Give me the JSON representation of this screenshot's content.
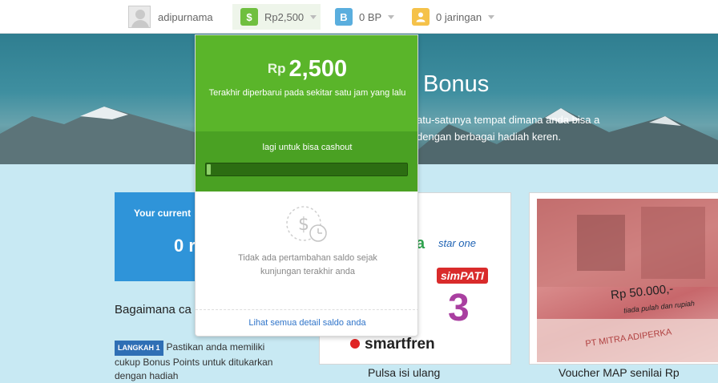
{
  "header": {
    "username": "adipurnama",
    "balance_label": "Rp2,500",
    "balance_icon_letter": "$",
    "bp_label": "0 BP",
    "bp_icon_letter": "B",
    "network_label": "0 jaringan",
    "colors": {
      "balance": "#6fbf3f",
      "bp": "#5aaede",
      "network": "#f5c24a"
    }
  },
  "hero": {
    "title": "Bonus",
    "text": "atu-satunya tempat dimana anda bisa a dengan berbagai hadiah keren."
  },
  "left": {
    "card_label": "Your current",
    "card_value": "0 r",
    "heading": "Bagaimana ca penukarannya",
    "step_badge": "LANGKAH 1",
    "step_text": "Pastikan anda memiliki cukup Bonus Points untuk ditukarkan dengan hadiah"
  },
  "rewards": [
    {
      "title": "Pulsa isi ulang",
      "logos": [
        "star one",
        "simPATI",
        "3",
        "smartfren"
      ]
    },
    {
      "title": "Voucher MAP senilai Rp",
      "image_caption": "Rp 50.000,-",
      "image_subcaption": "tiada pulah dan rupiah",
      "image_footer": "PT MITRA ADIPERKA"
    }
  ],
  "balance_panel": {
    "currency": "Rp",
    "amount": "2,500",
    "updated": "Terakhir diperbarui pada sekitar satu jam yang lalu",
    "cashout_text": "lagi untuk bisa cashout",
    "progress": 0.02,
    "empty_text": "Tidak ada pertambahan saldo sejak kunjungan terakhir anda",
    "link": "Lihat semua detail saldo anda",
    "icon": "dollar-clock-icon"
  }
}
